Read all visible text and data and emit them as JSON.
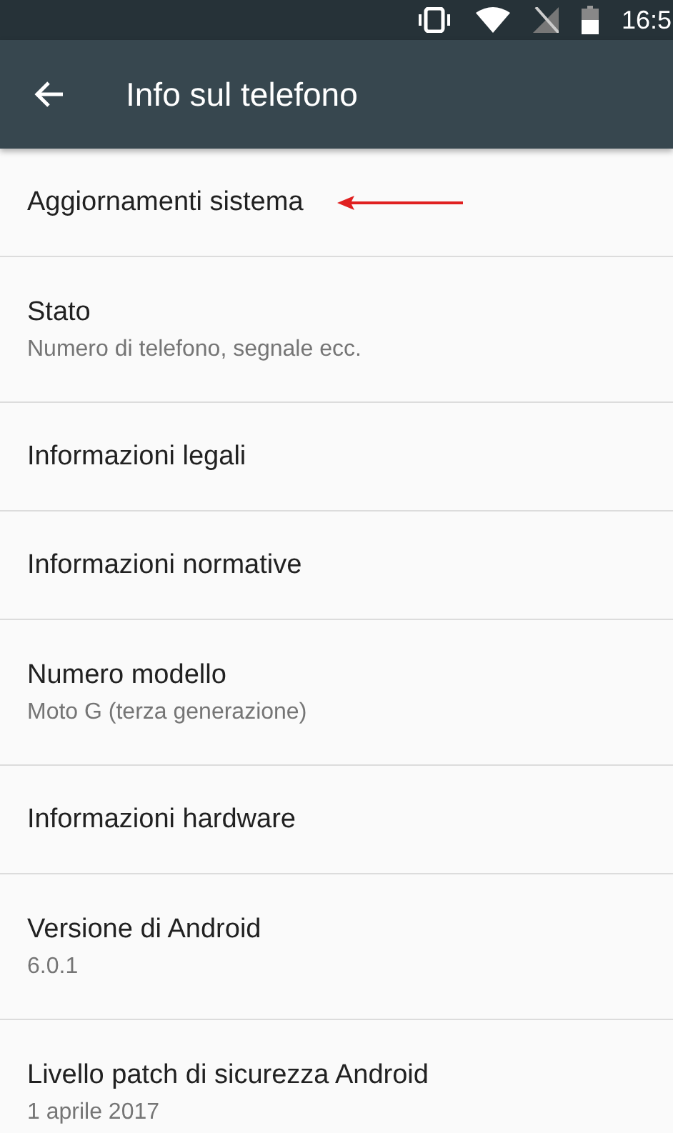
{
  "status_bar": {
    "time": "16:5"
  },
  "app_bar": {
    "title": "Info sul telefono"
  },
  "items": [
    {
      "title": "Aggiornamenti sistema",
      "annotated": true
    },
    {
      "title": "Stato",
      "subtitle": "Numero di telefono, segnale ecc.",
      "annotated": false
    },
    {
      "title": "Informazioni legali",
      "annotated": false
    },
    {
      "title": "Informazioni normative",
      "annotated": false
    },
    {
      "title": "Numero modello",
      "subtitle": "Moto G (terza generazione)",
      "annotated": false
    },
    {
      "title": "Informazioni hardware",
      "annotated": false
    },
    {
      "title": "Versione di Android",
      "subtitle": "6.0.1",
      "annotated": false
    },
    {
      "title": "Livello patch di sicurezza Android",
      "subtitle": "1 aprile 2017",
      "annotated": false
    }
  ]
}
